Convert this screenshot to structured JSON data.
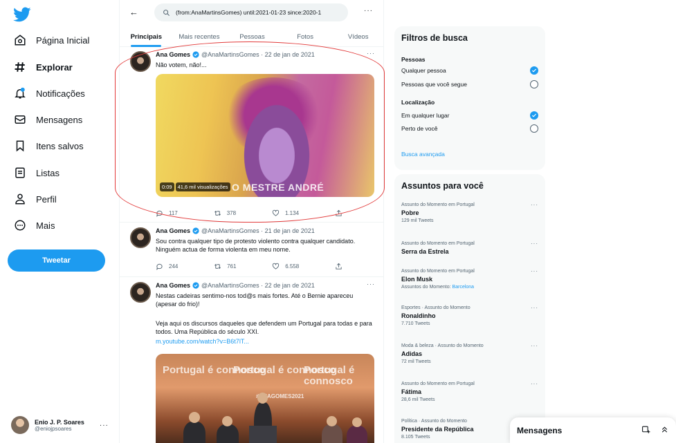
{
  "nav": {
    "items": [
      {
        "label": "Página Inicial",
        "icon": "home-icon"
      },
      {
        "label": "Explorar",
        "icon": "hashtag-icon"
      },
      {
        "label": "Notificações",
        "icon": "bell-icon"
      },
      {
        "label": "Mensagens",
        "icon": "mail-icon"
      },
      {
        "label": "Itens salvos",
        "icon": "bookmark-icon"
      },
      {
        "label": "Listas",
        "icon": "list-icon"
      },
      {
        "label": "Perfil",
        "icon": "person-icon"
      },
      {
        "label": "Mais",
        "icon": "more-circle-icon"
      }
    ],
    "active": "Explorar",
    "tweet_button": "Tweetar"
  },
  "account": {
    "name": "Enio J. P. Soares",
    "handle": "@eniojpsoares"
  },
  "search": {
    "query": "(from:AnaMartinsGomes) until:2021-01-23 since:2020-1"
  },
  "tabs": [
    {
      "label": "Principais",
      "active": true
    },
    {
      "label": "Mais recentes",
      "active": false
    },
    {
      "label": "Pessoas",
      "active": false
    },
    {
      "label": "Fotos",
      "active": false
    },
    {
      "label": "Vídeos",
      "active": false
    }
  ],
  "tweets": [
    {
      "name": "Ana Gomes",
      "meta": "@AnaMartinsGomes · 22 de jan de 2021",
      "text": "Não votem, não!...",
      "video_time": "0:09",
      "video_views": "41,6 mil visualizações",
      "video_overlay": "O MESTRE ANDRÉ",
      "replies": "117",
      "retweets": "378",
      "likes": "1.134"
    },
    {
      "name": "Ana Gomes",
      "meta": "@AnaMartinsGomes · 21 de jan de 2021",
      "text": "Sou contra qualquer tipo de protesto violento contra qualquer candidato. Ninguém actua de forma violenta em meu nome.",
      "replies": "244",
      "retweets": "761",
      "likes": "6.558"
    },
    {
      "name": "Ana Gomes",
      "meta": "@AnaMartinsGomes · 22 de jan de 2021",
      "text": "Nestas cadeiras sentimo-nos tod@s mais fortes. Até o Bernie apareceu (apesar do frio)!",
      "text2": "Veja aqui os discursos daqueles que defendem um Portugal para todas e para todos. Uma República do século XXI.",
      "link": "m.youtube.com/watch?v=B6t7lT...",
      "banner": "Portugal é connosco",
      "hashtag": "#ANAGOMES2021"
    }
  ],
  "filters": {
    "title": "Filtros de busca",
    "people_label": "Pessoas",
    "people_opts": [
      {
        "label": "Qualquer pessoa",
        "selected": true
      },
      {
        "label": "Pessoas que você segue",
        "selected": false
      }
    ],
    "location_label": "Localização",
    "location_opts": [
      {
        "label": "Em qualquer lugar",
        "selected": true
      },
      {
        "label": "Perto de você",
        "selected": false
      }
    ],
    "advanced": "Busca avançada"
  },
  "trends": {
    "title": "Assuntos para você",
    "items": [
      {
        "context": "Assunto do Momento em Portugal",
        "name": "Pobre",
        "count": "129 mil Tweets"
      },
      {
        "context": "Assunto do Momento em Portugal",
        "name": "Serra da Estrela",
        "count": ""
      },
      {
        "context": "Assunto do Momento em Portugal",
        "name": "Elon Musk",
        "count": "",
        "related_prefix": "Assuntos do Momento: ",
        "related": "Barcelona"
      },
      {
        "context": "Esportes · Assunto do Momento",
        "name": "Ronaldinho",
        "count": "7.710 Tweets"
      },
      {
        "context": "Moda & beleza · Assunto do Momento",
        "name": "Adidas",
        "count": "72 mil Tweets"
      },
      {
        "context": "Assunto do Momento em Portugal",
        "name": "Fátima",
        "count": "28,6 mil Tweets"
      },
      {
        "context": "Política · Assunto do Momento",
        "name": "Presidente da República",
        "count": "8.105 Tweets"
      }
    ]
  },
  "messages": {
    "label": "Mensagens"
  },
  "colors": {
    "accent": "#1d9bf0",
    "highlight_ring": "#e23b3b"
  }
}
